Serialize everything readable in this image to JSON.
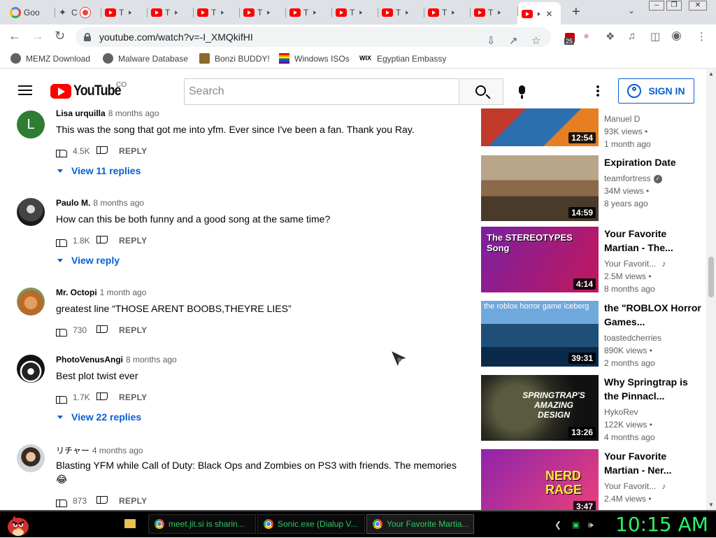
{
  "browser": {
    "tabs": [
      {
        "icon": "google-icon",
        "title": "Goo"
      },
      {
        "icon": "feather-icon",
        "title": ""
      },
      {
        "icon": "chrome-red-icon",
        "title": "C"
      },
      {
        "icon": "youtube-icon",
        "title": "T"
      },
      {
        "icon": "youtube-icon",
        "title": "T"
      },
      {
        "icon": "youtube-icon",
        "title": "T"
      },
      {
        "icon": "youtube-icon",
        "title": "T"
      },
      {
        "icon": "youtube-icon",
        "title": "T"
      },
      {
        "icon": "youtube-icon",
        "title": "T"
      },
      {
        "icon": "youtube-icon",
        "title": "T"
      },
      {
        "icon": "youtube-icon",
        "title": "T"
      },
      {
        "icon": "youtube-icon",
        "title": "T"
      }
    ],
    "new_tab": "+",
    "address": "youtube.com/watch?v=-I_XMQkifHI",
    "extension_badge": "25",
    "bookmarks": [
      {
        "label": "MEMZ Download"
      },
      {
        "label": "Malware Database"
      },
      {
        "label": "Bonzi BUDDY!"
      },
      {
        "label": "Windows ISOs"
      },
      {
        "label": "Egyptian Embassy"
      }
    ]
  },
  "youtube": {
    "logo_text": "YouTube",
    "country_code": "CO",
    "search_placeholder": "Search",
    "sign_in": "SIGN IN"
  },
  "comments": [
    {
      "author": "Lisa urquilla",
      "time": "8 months ago",
      "text": "This was the song that got me into yfm. Ever since I've been a fan. Thank you Ray.",
      "likes": "4.5K",
      "reply": "REPLY",
      "replies": "View 11 replies",
      "avatar_letter": "L",
      "avatar_color": "#2e7d32"
    },
    {
      "author": "Paulo M.",
      "time": "8 months ago",
      "text": "How can this be both funny and a good song at the same time?",
      "likes": "1.8K",
      "reply": "REPLY",
      "replies": "View reply"
    },
    {
      "author": "Mr. Octopi",
      "time": "1 month ago",
      "text": "greatest line “THOSE ARENT BOOBS,THEYRE LIES”",
      "likes": "730",
      "reply": "REPLY",
      "replies": ""
    },
    {
      "author": "PhotoVenusAngi",
      "time": "8 months ago",
      "text": "Best plot twist ever",
      "likes": "1.7K",
      "reply": "REPLY",
      "replies": "View 22 replies"
    },
    {
      "author": "リチャー",
      "time": "4 months ago",
      "text": "Blasting YFM while Call of Duty: Black Ops and Zombies on PS3 with friends.  The memories 😂",
      "likes": "873",
      "reply": "REPLY",
      "replies": ""
    }
  ],
  "recommendations": [
    {
      "title": "",
      "channel": "Manuel D",
      "views": "93K views",
      "age": "1 month ago",
      "duration": "12:54",
      "verified": false,
      "music": false
    },
    {
      "title": "Expiration Date",
      "channel": "teamfortress",
      "views": "34M views",
      "age": "8 years ago",
      "duration": "14:59",
      "verified": true,
      "music": false
    },
    {
      "title": "Your Favorite Martian - The...",
      "channel": "Your Favorit...",
      "views": "2.5M views",
      "age": "8 months ago",
      "duration": "4:14",
      "verified": false,
      "music": true,
      "thumb_text": "The STEREOTYPES Song"
    },
    {
      "title": "the \"ROBLOX Horror Games...",
      "channel": "toastedcherries",
      "views": "890K views",
      "age": "2 months ago",
      "duration": "39:31",
      "verified": false,
      "music": false,
      "thumb_text": "the roblox horror game iceberg"
    },
    {
      "title": "Why Springtrap is the Pinnacl...",
      "channel": "HykoRev",
      "views": "122K views",
      "age": "4 months ago",
      "duration": "13:26",
      "verified": false,
      "music": false,
      "thumb_text": "SPRINGTRAP'S AMAZING DESIGN"
    },
    {
      "title": "Your Favorite Martian - Ner...",
      "channel": "Your Favorit...",
      "views": "2.4M views",
      "age": "",
      "duration": "3:47",
      "verified": false,
      "music": true,
      "thumb_text": "NERD RAGE"
    }
  ],
  "taskbar": {
    "tasks": [
      {
        "label": "meet.jit.si is sharin..."
      },
      {
        "label": "Sonic.exe (Dialup V..."
      },
      {
        "label": "Your Favorite Martia..."
      }
    ],
    "clock": "10:15 AM"
  },
  "colors": {
    "youtube_red": "#ff0000",
    "link_blue": "#065fd4",
    "clock_green": "#2ef067"
  }
}
